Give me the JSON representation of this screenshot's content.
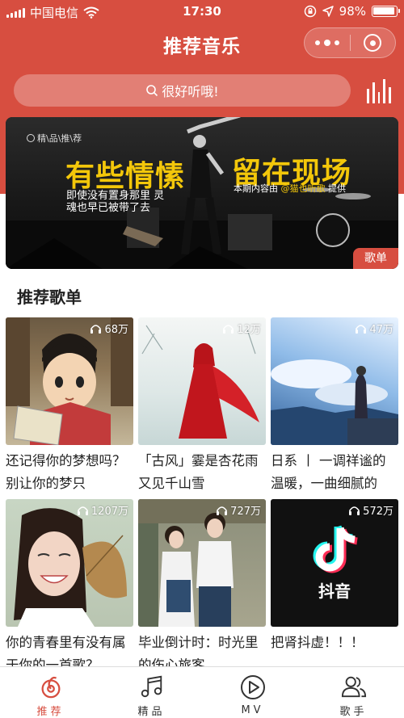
{
  "status_bar": {
    "carrier": "中国电信",
    "time": "17:30",
    "battery": "98%"
  },
  "nav": {
    "title": "推荐音乐"
  },
  "search": {
    "placeholder": "很好听哦!"
  },
  "banner": {
    "tagline": "精\\品\\推\\荐",
    "headline_left": "有些情愫",
    "headline_right": "留在现场",
    "sub_left": "即使没有置身那里 灵魂也早已被带了去",
    "sub_right_prefix": "本期内容由",
    "sub_right_source": "@猫也听歌",
    "sub_right_suffix": "提供",
    "tag": "歌单"
  },
  "section": {
    "title": "推荐歌单"
  },
  "playlists": [
    {
      "plays": "68万",
      "name": "还记得你的梦想吗？别让你的梦只"
    },
    {
      "plays": "12万",
      "name": "「古风」霎是杏花雨又见千山雪"
    },
    {
      "plays": "47万",
      "name": "日系 丨 一调祥谧的温暖，一曲细腻的"
    },
    {
      "plays": "1207万",
      "name": "你的青春里有没有属于你的一首歌？"
    },
    {
      "plays": "727万",
      "name": "毕业倒计时：时光里的伤心旅客"
    },
    {
      "plays": "572万",
      "name": "把肾抖虚！！！"
    }
  ],
  "tiktok_label": "抖音",
  "tabs": [
    {
      "label": "推荐",
      "icon": "recommend-icon",
      "active": true
    },
    {
      "label": "精品",
      "icon": "music-note-icon",
      "active": false
    },
    {
      "label": "MV",
      "icon": "play-circle-icon",
      "active": false
    },
    {
      "label": "歌手",
      "icon": "singer-icon",
      "active": false
    }
  ],
  "colors": {
    "accent": "#d74e40",
    "banner_text": "#f3c70a"
  }
}
